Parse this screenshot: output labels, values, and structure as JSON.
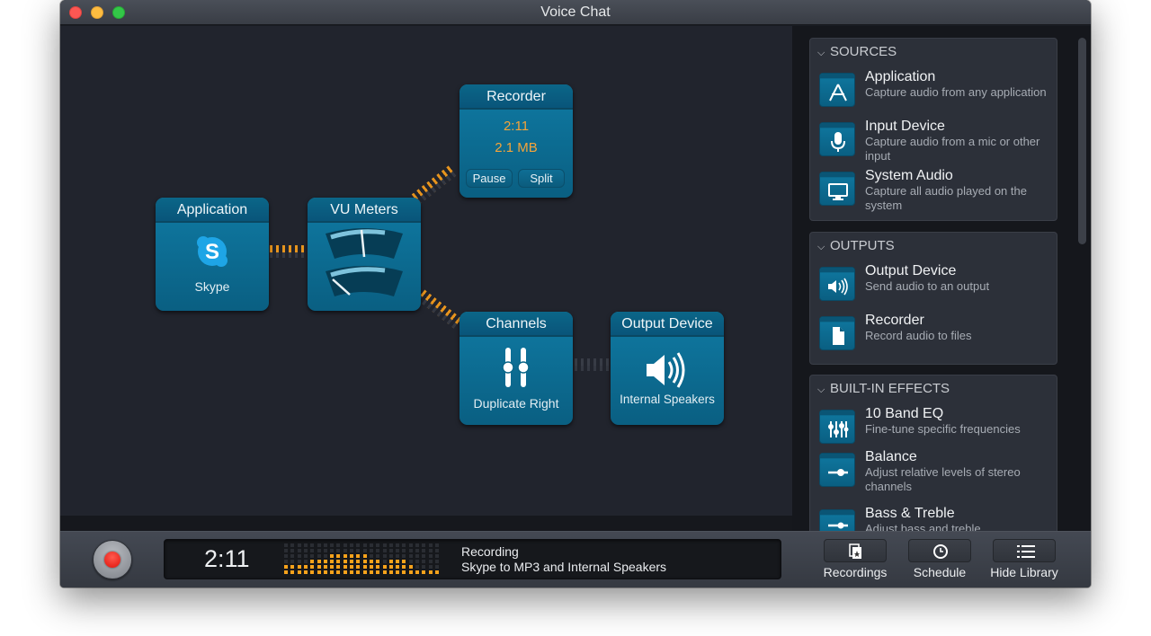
{
  "window": {
    "title": "Voice Chat"
  },
  "nodes": {
    "application": {
      "title": "Application",
      "subtitle": "Skype",
      "icon": "skype-icon"
    },
    "vu_meters": {
      "title": "VU Meters",
      "levels": [
        0.55,
        0.1
      ]
    },
    "recorder": {
      "title": "Recorder",
      "time": "2:11",
      "size": "2.1 MB",
      "pause_label": "Pause",
      "split_label": "Split"
    },
    "channels": {
      "title": "Channels",
      "subtitle": "Duplicate Right",
      "icon": "sliders-icon"
    },
    "output_device": {
      "title": "Output Device",
      "subtitle": "Internal Speakers",
      "icon": "speaker-icon"
    }
  },
  "library": {
    "sections": [
      {
        "title": "SOURCES",
        "items": [
          {
            "name": "Application",
            "desc": "Capture audio from any application",
            "icon": "app-store-icon"
          },
          {
            "name": "Input Device",
            "desc": "Capture audio from a mic or other input",
            "icon": "microphone-icon"
          },
          {
            "name": "System Audio",
            "desc": "Capture all audio played on the system",
            "icon": "monitor-icon"
          }
        ]
      },
      {
        "title": "OUTPUTS",
        "items": [
          {
            "name": "Output Device",
            "desc": "Send audio to an output",
            "icon": "speaker-icon"
          },
          {
            "name": "Recorder",
            "desc": "Record audio to files",
            "icon": "file-icon"
          }
        ]
      },
      {
        "title": "BUILT-IN EFFECTS",
        "items": [
          {
            "name": "10 Band EQ",
            "desc": "Fine-tune specific frequencies",
            "icon": "eq-icon"
          },
          {
            "name": "Balance",
            "desc": "Adjust relative levels of stereo channels",
            "icon": "balance-icon"
          },
          {
            "name": "Bass & Treble",
            "desc": "Adjust bass and treble",
            "icon": "bass-treble-icon"
          }
        ]
      }
    ]
  },
  "toolbar": {
    "time": "2:11",
    "status_line1": "Recording",
    "status_line2": "Skype to MP3 and Internal Speakers",
    "level_meter": [
      2,
      2,
      2,
      2,
      3,
      3,
      3,
      4,
      4,
      4,
      4,
      4,
      4,
      3,
      3,
      2,
      3,
      3,
      3,
      2,
      1,
      1,
      1,
      1
    ],
    "level_meter_rows": 6,
    "buttons": [
      {
        "label": "Recordings",
        "icon": "recordings-icon"
      },
      {
        "label": "Schedule",
        "icon": "clock-icon"
      },
      {
        "label": "Hide Library",
        "icon": "list-icon"
      }
    ]
  },
  "colors": {
    "accent": "#0f78a0",
    "meter": "#f7a21b",
    "record": "#e0120a"
  }
}
